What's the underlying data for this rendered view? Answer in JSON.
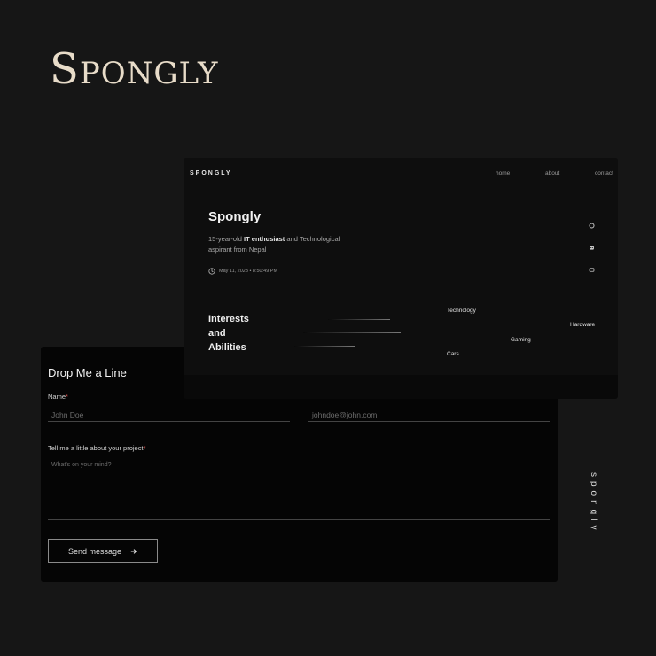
{
  "brand": {
    "title": "Spongly",
    "vertical": "spongly"
  },
  "contact": {
    "heading": "Drop Me a Line",
    "name_label": "Name",
    "required_mark": "*",
    "name_placeholder": "John Doe",
    "email_placeholder": "johndoe@john.com",
    "project_label": "Tell me a little about your project",
    "project_placeholder": "What's on your mind?",
    "send_label": "Send message",
    "send_icon": "arrow-right-icon"
  },
  "site": {
    "logo": "SPONGLY",
    "nav": [
      "home",
      "about",
      "contact"
    ],
    "hero": {
      "name": "Spongly",
      "tagline_pre": "15-year-old ",
      "tagline_bold": "IT enthusiast",
      "tagline_post": " and Technological aspirant from Nepal",
      "datetime": "May 11, 2023 • 8:50:49 PM"
    },
    "social_icons": [
      "github-icon",
      "discord-icon",
      "mail-icon"
    ],
    "interests_title": [
      "Interests",
      "and",
      "Abilities"
    ],
    "skills": [
      "Technology",
      "Hardware",
      "Gaming",
      "Cars"
    ]
  }
}
